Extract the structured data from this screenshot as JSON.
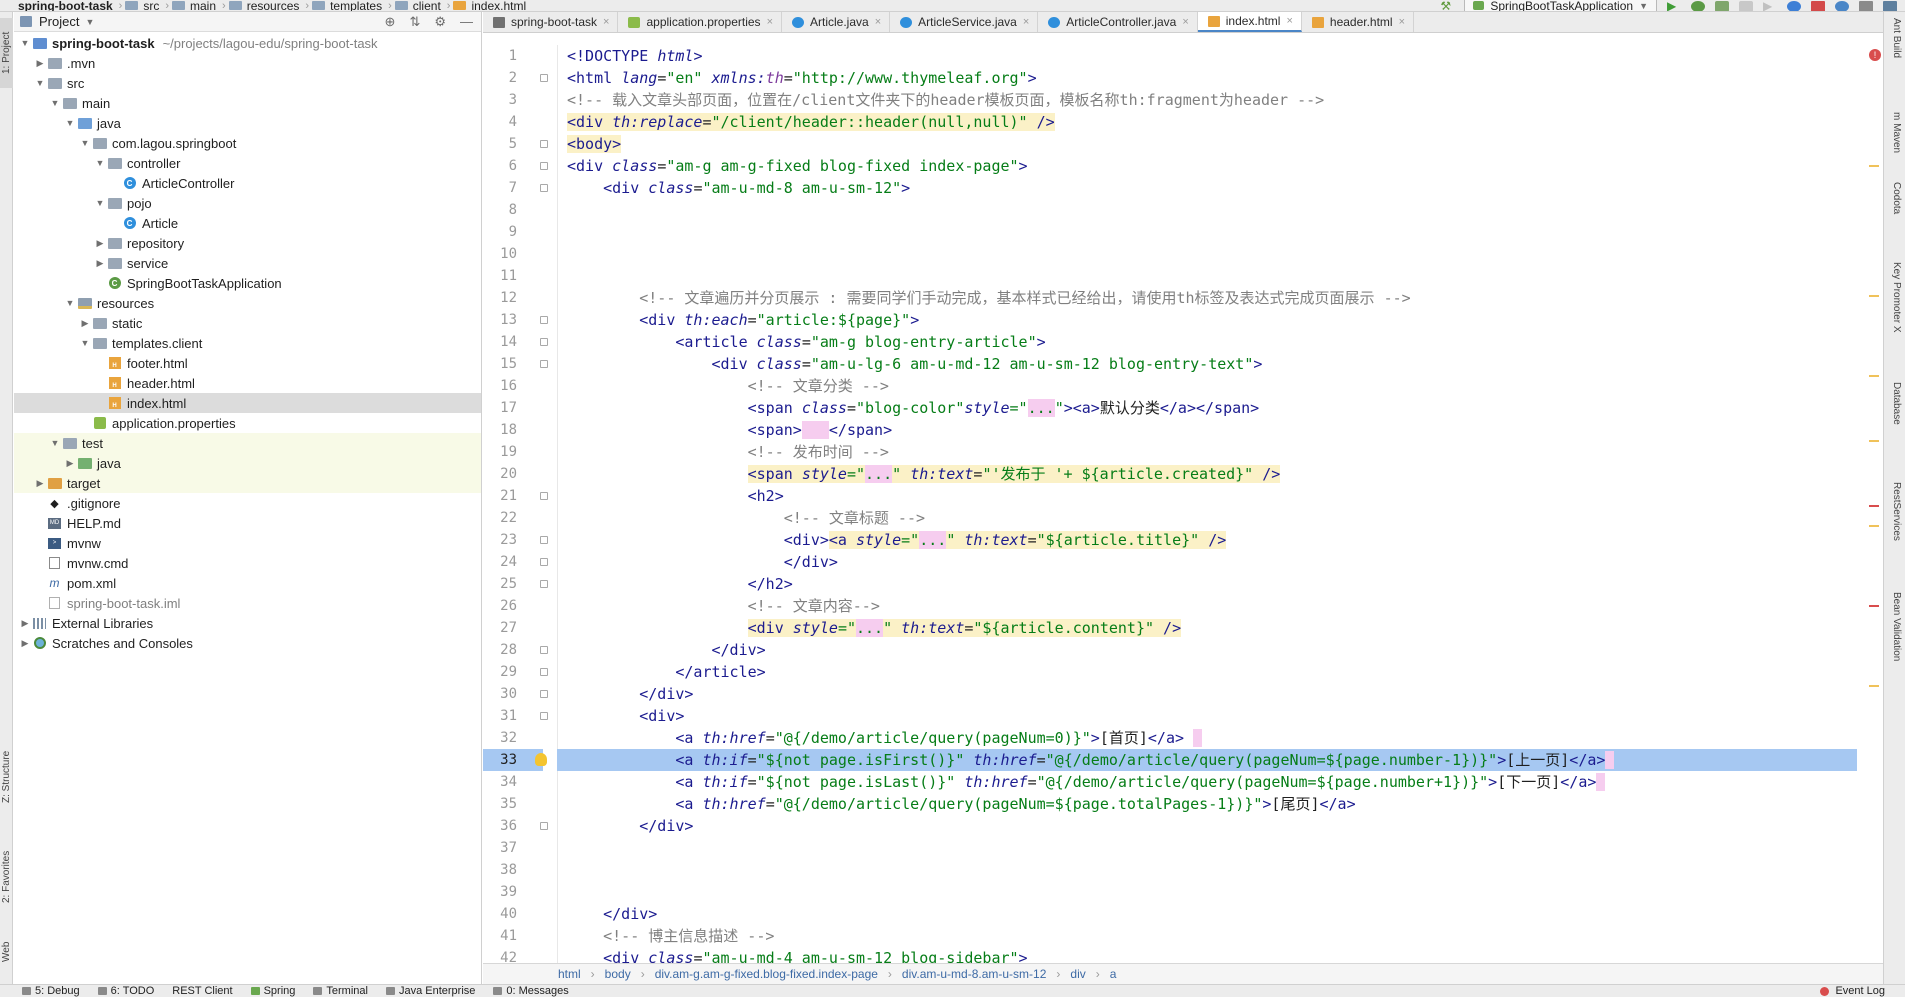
{
  "navbar": {
    "crumbs": [
      "spring-boot-task",
      "src",
      "main",
      "resources",
      "templates",
      "client",
      "index.html"
    ],
    "run_config": "SpringBootTaskApplication"
  },
  "left_strip": {
    "project_tab": "1: Project",
    "structure_tab": "Z: Structure",
    "favorites_tab": "2: Favorites",
    "web_tab": "Web"
  },
  "project": {
    "title": "Project",
    "tree": [
      {
        "label": "spring-boot-task",
        "sub": "~/projects/lagou-edu/spring-boot-task"
      },
      {
        "label": ".mvn"
      },
      {
        "label": "src"
      },
      {
        "label": "main"
      },
      {
        "label": "java"
      },
      {
        "label": "com.lagou.springboot"
      },
      {
        "label": "controller"
      },
      {
        "label": "ArticleController"
      },
      {
        "label": "pojo"
      },
      {
        "label": "Article"
      },
      {
        "label": "repository"
      },
      {
        "label": "service"
      },
      {
        "label": "SpringBootTaskApplication"
      },
      {
        "label": "resources"
      },
      {
        "label": "static"
      },
      {
        "label": "templates.client"
      },
      {
        "label": "footer.html"
      },
      {
        "label": "header.html"
      },
      {
        "label": "index.html"
      },
      {
        "label": "application.properties"
      },
      {
        "label": "test"
      },
      {
        "label": "java"
      },
      {
        "label": "target"
      },
      {
        "label": ".gitignore"
      },
      {
        "label": "HELP.md"
      },
      {
        "label": "mvnw"
      },
      {
        "label": "mvnw.cmd"
      },
      {
        "label": "pom.xml"
      },
      {
        "label": "spring-boot-task.iml"
      },
      {
        "label": "External Libraries"
      },
      {
        "label": "Scratches and Consoles"
      }
    ]
  },
  "tabs": [
    "spring-boot-task",
    "application.properties",
    "Article.java",
    "ArticleService.java",
    "ArticleController.java",
    "index.html",
    "header.html"
  ],
  "active_tab": "index.html",
  "code": {
    "l1a": "<!DOCTYPE ",
    "l1b": "html",
    "l1c": ">",
    "l2a": "<html ",
    "l2b": "lang",
    "l2c": "=",
    "l2d": "\"en\"",
    "l2e": " xmlns:",
    "l2f": "th",
    "l2g": "=",
    "l2h": "\"http://www.thymeleaf.org\"",
    "l2i": ">",
    "l3": "<!-- 载入文章头部页面，位置在/client文件夹下的header模板页面，模板名称th:fragment为header -->",
    "l4a": "<div ",
    "l4b": "th:replace",
    "l4c": "=",
    "l4d": "\"/client/header::header(null,null)\"",
    "l4e": " />",
    "l5": "<body>",
    "l6a": "<div ",
    "l6b": "class",
    "l6c": "=",
    "l6d": "\"am-g am-g-fixed blog-fixed index-page\"",
    "l6e": ">",
    "l7a": "<div ",
    "l7b": "class",
    "l7c": "=",
    "l7d": "\"am-u-md-8 am-u-sm-12\"",
    "l7e": ">",
    "l12": "<!-- 文章遍历并分页展示 : 需要同学们手动完成，基本样式已经给出，请使用th标签及表达式完成页面展示 -->",
    "l13a": "<div ",
    "l13b": "th:each",
    "l13c": "=",
    "l13d": "\"article:${page}\"",
    "l13e": ">",
    "l14a": "<article ",
    "l14b": "class",
    "l14c": "=",
    "l14d": "\"am-g blog-entry-article\"",
    "l14e": ">",
    "l15a": "<div ",
    "l15b": "class",
    "l15c": "=",
    "l15d": "\"am-u-lg-6 am-u-md-12 am-u-sm-12 blog-entry-text\"",
    "l15e": ">",
    "l16": "<!-- 文章分类 -->",
    "l17a": "<span ",
    "l17b": "class",
    "l17c": "=",
    "l17d": "\"blog-color\"",
    "l17e": "style",
    "l17f": "=\"",
    "l17g": "...",
    "l17h": "\"",
    "l17i": "><a>",
    "l17j": "默认分类",
    "l17k": "</a></span>",
    "l18a": "<span>",
    "l18b": "</span>",
    "l19": "<!-- 发布时间 -->",
    "l20a": "<span ",
    "l20b": "style",
    "l20c": "=\"",
    "l20d": "...",
    "l20e": "\" ",
    "l20f": "th:text",
    "l20g": "=",
    "l20h": "\"'发布于 '+ ${article.created}\"",
    "l20i": " />",
    "l21": "<h2>",
    "l22": "<!-- 文章标题 -->",
    "l23a": "<div>",
    "l23b": "<a ",
    "l23c": "style",
    "l23d": "=\"",
    "l23e": "...",
    "l23f": "\" ",
    "l23g": "th:text",
    "l23h": "=",
    "l23i": "\"${article.title}\"",
    "l23j": " />",
    "l24": "</div>",
    "l25": "</h2>",
    "l26": "<!-- 文章内容-->",
    "l27a": "<div ",
    "l27b": "style",
    "l27c": "=\"",
    "l27d": "...",
    "l27e": "\" ",
    "l27f": "th:text",
    "l27g": "=",
    "l27h": "\"${article.content}\"",
    "l27i": " />",
    "l28": "</div>",
    "l29": "</article>",
    "l30": "</div>",
    "l31": "<div>",
    "l32a": "<a ",
    "l32b": "th:href",
    "l32c": "=",
    "l32d": "\"@{/demo/article/query(pageNum=0)}\"",
    "l32e": ">",
    "l32f": "[首页]",
    "l32g": "</a>",
    "l33a": "<a ",
    "l33b": "th:if",
    "l33c": "=",
    "l33d": "\"${not page.isFirst()}\"",
    "l33e": " th:href",
    "l33f": "=",
    "l33g": "\"@{/demo/article/query(pageNum=${page.number-1})}\"",
    "l33h": ">",
    "l33i": "[上一页]",
    "l33j": "</a>",
    "l34a": "<a ",
    "l34b": "th:if",
    "l34c": "=",
    "l34d": "\"${not page.isLast()}\"",
    "l34e": " th:href",
    "l34f": "=",
    "l34g": "\"@{/demo/article/query(pageNum=${page.number+1})}\"",
    "l34h": ">",
    "l34i": "[下一页]",
    "l34j": "</a>",
    "l35a": "<a ",
    "l35b": "th:href",
    "l35c": "=",
    "l35d": "\"@{/demo/article/query(pageNum=${page.totalPages-1})}\"",
    "l35e": ">",
    "l35f": "[尾页]",
    "l35g": "</a>",
    "l36": "</div>",
    "l40": "</div>",
    "l41": "<!-- 博主信息描述 -->",
    "l42a": "<div ",
    "l42b": "class",
    "l42c": "=",
    "l42d": "\"am-u-md-4 am-u-sm-12 blog-sidebar\"",
    "l42e": ">"
  },
  "line_numbers": [
    "1",
    "2",
    "3",
    "4",
    "5",
    "6",
    "7",
    "8",
    "9",
    "10",
    "11",
    "12",
    "13",
    "14",
    "15",
    "16",
    "17",
    "18",
    "19",
    "20",
    "21",
    "22",
    "23",
    "24",
    "25",
    "26",
    "27",
    "28",
    "29",
    "30",
    "31",
    "32",
    "33",
    "34",
    "35",
    "36",
    "37",
    "38",
    "39",
    "40",
    "41",
    "42"
  ],
  "editor_breadcrumb": [
    "html",
    "body",
    "div.am-g.am-g-fixed.blog-fixed.index-page",
    "div.am-u-md-8.am-u-sm-12",
    "div",
    "a"
  ],
  "right_strip": [
    "Ant Build",
    "m Maven",
    "Codota",
    "Key Promoter X",
    "Database",
    "RestServices",
    "Bean Validation"
  ],
  "bottombar": {
    "items": [
      "5: Debug",
      "6: TODO",
      "REST Client",
      "Spring",
      "Terminal",
      "Java Enterprise",
      "0: Messages"
    ],
    "event_log": "Event Log"
  },
  "colors": {
    "selection": "#a6c8f2",
    "tag": "#1b1b8f",
    "string": "#067d17",
    "comment": "#808080",
    "accent": "#4a86c7"
  }
}
